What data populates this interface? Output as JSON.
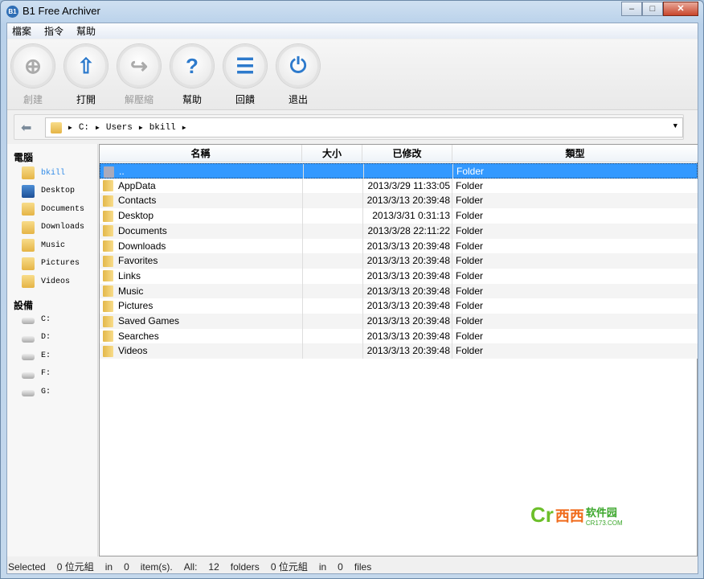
{
  "window": {
    "title": "B1 Free Archiver",
    "icon_text": "B1",
    "minimize": "–",
    "maximize": "□",
    "close": "✕"
  },
  "menu": [
    "檔案",
    "指令",
    "幫助"
  ],
  "toolbar": [
    {
      "label": "創建",
      "glyph": "⊕",
      "enabled": false
    },
    {
      "label": "打開",
      "glyph": "⇧",
      "enabled": true
    },
    {
      "label": "解壓縮",
      "glyph": "↪",
      "enabled": false
    },
    {
      "label": "幫助",
      "glyph": "?",
      "enabled": true
    },
    {
      "label": "回饋",
      "glyph": "☰",
      "enabled": true
    },
    {
      "label": "退出",
      "glyph": "⏻",
      "enabled": true
    }
  ],
  "address": {
    "back": "⬅",
    "segments": [
      "C:",
      "Users",
      "bkill"
    ]
  },
  "sidebar": {
    "computer_heading": "電腦",
    "places": [
      "bkill",
      "Desktop",
      "Documents",
      "Downloads",
      "Music",
      "Pictures",
      "Videos"
    ],
    "devices_heading": "設備",
    "drives": [
      "C:",
      "D:",
      "E:",
      "F:",
      "G:"
    ]
  },
  "columns": {
    "name": "名稱",
    "size": "大小",
    "modified": "已修改",
    "type": "類型"
  },
  "rows": [
    {
      "name": "..",
      "size": "",
      "modified": "",
      "type": "Folder"
    },
    {
      "name": "AppData",
      "size": "",
      "modified": "2013/3/29 11:33:05",
      "type": "Folder"
    },
    {
      "name": "Contacts",
      "size": "",
      "modified": "2013/3/13 20:39:48",
      "type": "Folder"
    },
    {
      "name": "Desktop",
      "size": "",
      "modified": "2013/3/31 0:31:13",
      "type": "Folder"
    },
    {
      "name": "Documents",
      "size": "",
      "modified": "2013/3/28 22:11:22",
      "type": "Folder"
    },
    {
      "name": "Downloads",
      "size": "",
      "modified": "2013/3/13 20:39:48",
      "type": "Folder"
    },
    {
      "name": "Favorites",
      "size": "",
      "modified": "2013/3/13 20:39:48",
      "type": "Folder"
    },
    {
      "name": "Links",
      "size": "",
      "modified": "2013/3/13 20:39:48",
      "type": "Folder"
    },
    {
      "name": "Music",
      "size": "",
      "modified": "2013/3/13 20:39:48",
      "type": "Folder"
    },
    {
      "name": "Pictures",
      "size": "",
      "modified": "2013/3/13 20:39:48",
      "type": "Folder"
    },
    {
      "name": "Saved Games",
      "size": "",
      "modified": "2013/3/13 20:39:48",
      "type": "Folder"
    },
    {
      "name": "Searches",
      "size": "",
      "modified": "2013/3/13 20:39:48",
      "type": "Folder"
    },
    {
      "name": "Videos",
      "size": "",
      "modified": "2013/3/13 20:39:48",
      "type": "Folder"
    }
  ],
  "watermark": {
    "c": "Cr",
    "xi": "西西",
    "soft": "软件园",
    "url": "CR173.COM"
  },
  "status": [
    "Selected",
    "0 位元組",
    "in",
    "0",
    "item(s).",
    "All:",
    "12",
    "folders",
    "0 位元組",
    "in",
    "0",
    "files"
  ]
}
